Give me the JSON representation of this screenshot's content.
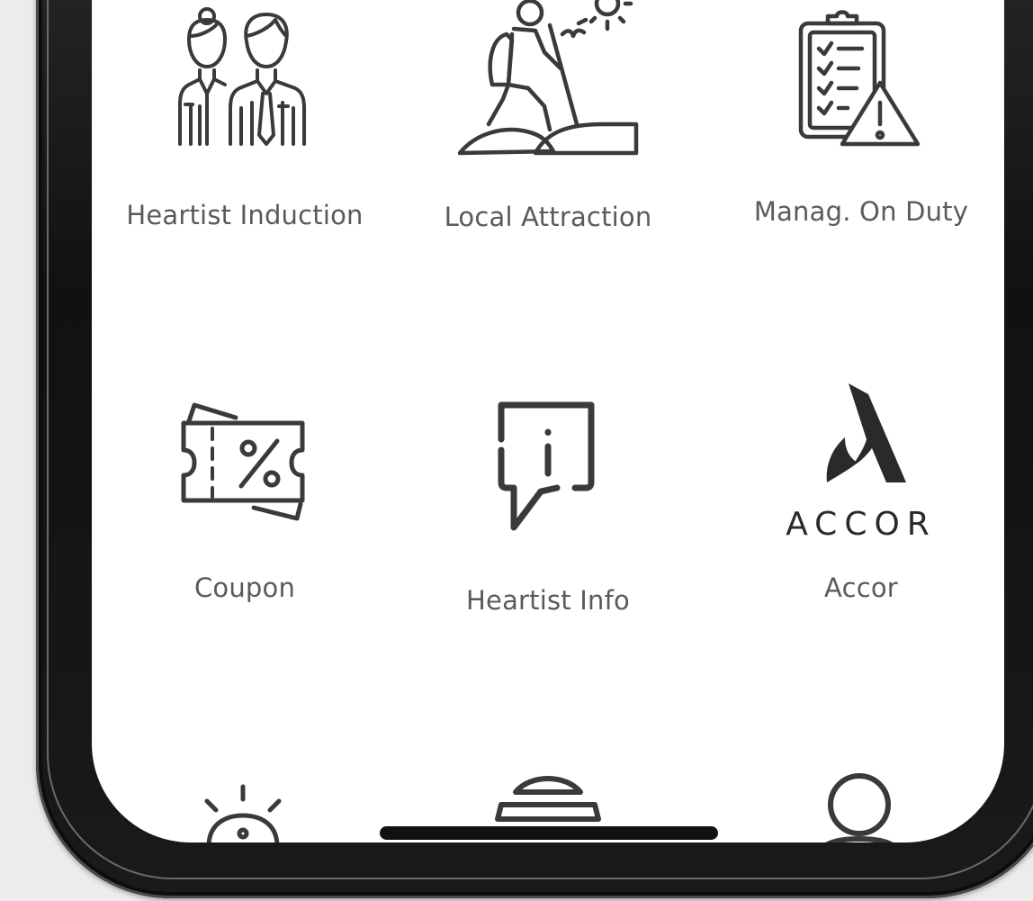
{
  "grid": {
    "row1": [
      {
        "label": "Heartist Induction",
        "icon": "staff-couple-icon"
      },
      {
        "label": "Local Attraction",
        "icon": "hiker-icon"
      },
      {
        "label": "Manag. On Duty",
        "icon": "clipboard-warning-icon"
      }
    ],
    "row2": [
      {
        "label": "Coupon",
        "icon": "coupon-ticket-icon"
      },
      {
        "label": "Heartist Info",
        "icon": "info-speech-bubble-icon"
      },
      {
        "label": "Accor",
        "icon": "accor-logo"
      }
    ],
    "row3": [
      {
        "icon": "sunrise-icon"
      },
      {
        "icon": "food-cloche-icon"
      },
      {
        "icon": "person-icon"
      }
    ]
  },
  "brand": {
    "accor_wordmark": "ACCOR"
  },
  "colors": {
    "icon_stroke": "#3a3a3a",
    "label_text": "#5a5a5a",
    "screen_bg": "#ffffff",
    "page_bg": "#ececec"
  }
}
